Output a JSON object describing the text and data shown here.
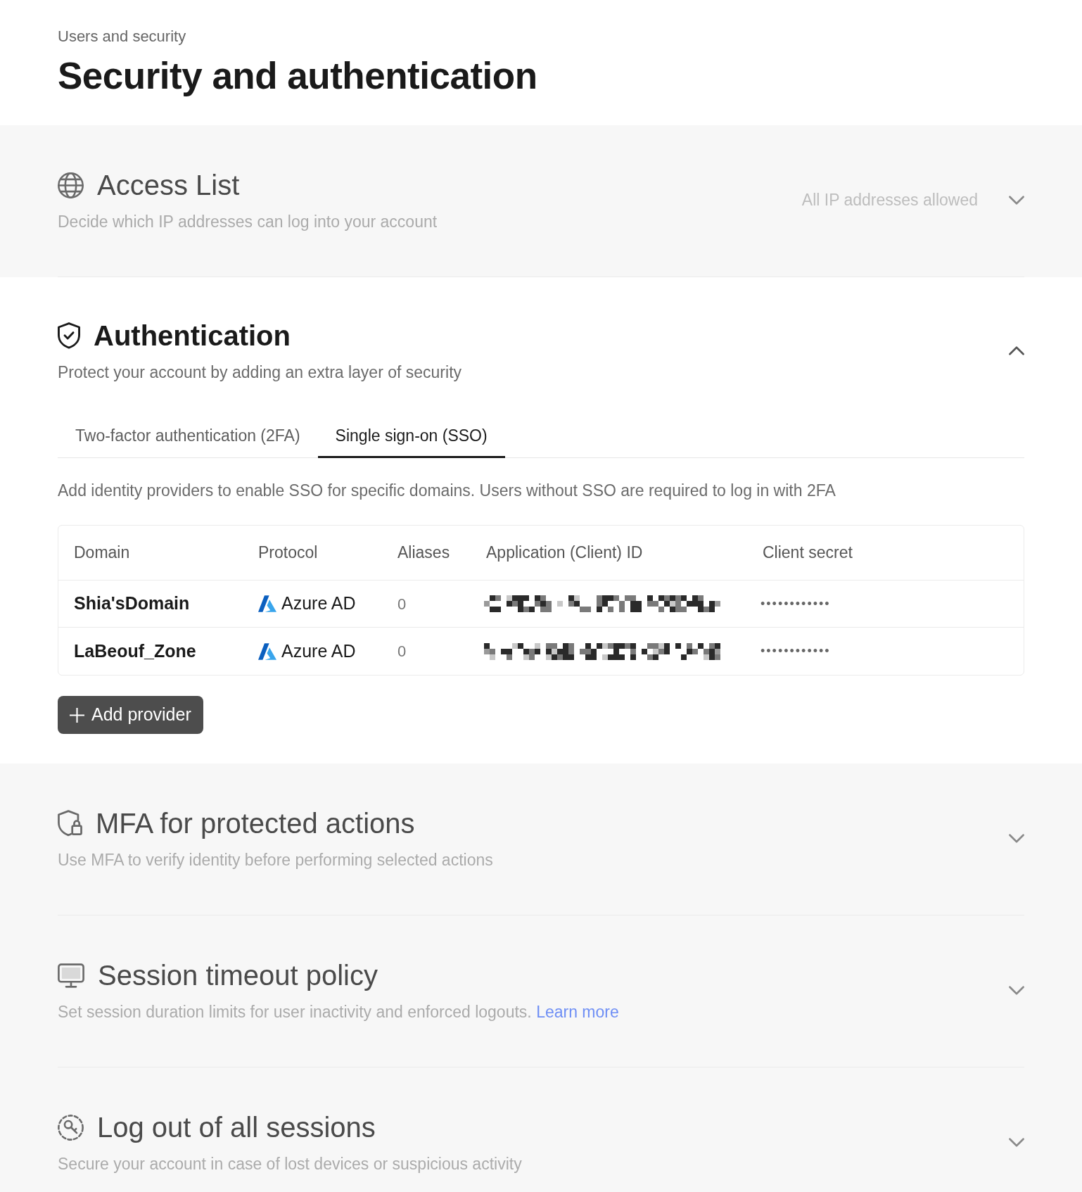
{
  "breadcrumb": "Users and security",
  "page_title": "Security and authentication",
  "sections": [
    {
      "title": "Access List",
      "description": "Decide which IP addresses can log into your account",
      "status": "All IP addresses allowed",
      "expanded": false
    },
    {
      "title": "Authentication",
      "description": "Protect your account by adding an extra layer of security",
      "expanded": true,
      "tabs": [
        {
          "label": "Two-factor authentication (2FA)",
          "selected": false
        },
        {
          "label": "Single sign-on (SSO)",
          "selected": true
        }
      ],
      "intro": "Add identity providers to enable SSO for specific domains. Users without SSO are required to log in with 2FA",
      "table": {
        "columns": [
          "Domain",
          "Protocol",
          "Aliases",
          "Application (Client) ID",
          "Client secret"
        ],
        "rows": [
          {
            "domain": "Shia'sDomain",
            "protocol": "Azure AD",
            "aliases": "0",
            "client_secret": "••••••••••••"
          },
          {
            "domain": "LaBeouf_Zone",
            "protocol": "Azure AD",
            "aliases": "0",
            "client_secret": "••••••••••••"
          }
        ]
      },
      "add_button": "Add provider"
    },
    {
      "title": "MFA for protected actions",
      "description": "Use MFA to verify identity before performing selected actions",
      "expanded": false
    },
    {
      "title": "Session timeout policy",
      "description": "Set session duration limits for user inactivity and enforced logouts.",
      "link": "Learn more",
      "expanded": false
    },
    {
      "title": "Log out of all sessions",
      "description": "Secure your account in case of lost devices or suspicious activity",
      "expanded": false
    }
  ]
}
